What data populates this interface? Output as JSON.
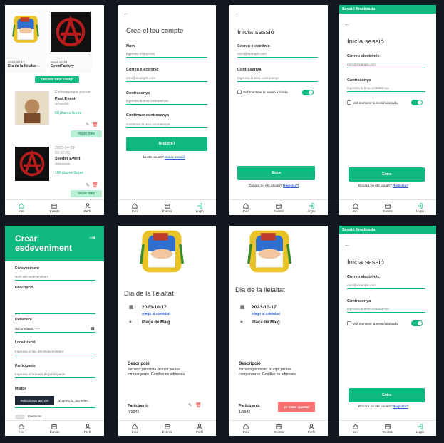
{
  "colors": {
    "accent": "#10b981",
    "danger": "#f87171",
    "link": "#2f5fd0"
  },
  "nav": {
    "home": "Inici",
    "events": "Events",
    "profile": "Perfil",
    "login": "Login"
  },
  "s1": {
    "cards": [
      {
        "date": "2023-10-17",
        "title": "Dia de la lleialtat"
      },
      {
        "date": "2023-12-31",
        "title": "EventFactory"
      }
    ],
    "create_btn": "CREATE NEW EVENT",
    "events": [
      {
        "status": "Esdeveniment passat",
        "title": "Past Event",
        "org": "@Factoria5",
        "places": "50 places lliures",
        "more": "Veure més"
      },
      {
        "date": "2023-04-29",
        "time": "00:00:00",
        "title": "Seeder Event",
        "org": "@Barcelona",
        "places": "100 places lliures",
        "more": "Veure més"
      }
    ]
  },
  "s2": {
    "title": "Crea el teu compte",
    "name_label": "Nom",
    "name_ph": "Ingressa el teu nom",
    "email_label": "Correu electrònic",
    "email_ph": "nom@example.com",
    "pass_label": "Contrasenya",
    "pass_ph": "Ingressa la teva contrasenya",
    "conf_label": "Confirmar contrasenya",
    "conf_ph": "Confirmar la teva contrasenya",
    "btn": "Registra't",
    "q": "Ja ets usuari?",
    "link": "Inicia sessió"
  },
  "login": {
    "title": "Inicia sessió",
    "email_label": "Correu electrònic",
    "email_ph": "nom@example.com",
    "pass_label": "Contrasenya",
    "pass_ph": "Ingressa la teva contrasenya",
    "remember": "Vull mantenir la sessió iniciada",
    "btn": "Entra",
    "q": "Encara no ets usuari?",
    "link": "Registra't",
    "banner": "Sessió finalitzada"
  },
  "s5": {
    "title": "Crear esdeveniment",
    "ev_label": "Esdeveniment",
    "ev_ph": "Nom del esdeveniment",
    "desc_label": "Descripció",
    "date_label": "Data/Hora",
    "date_ph": "dd/mm/aaaa, --:--",
    "loc_label": "Localització",
    "loc_ph": "Ingressa el lloc del esdeveniment",
    "part_label": "Participants",
    "part_ph": "Ingressa el número de participants",
    "img_label": "Imatge",
    "file_btn": "Seleccionar archivo",
    "file_name": "Ninguno a...ivo selec.",
    "featured": "Destacat"
  },
  "detail": {
    "title": "Dia de la lleialtat",
    "date": "2023-10-17",
    "cal": "Afegir al calendari",
    "place": "Plaça de Maig",
    "desc_label": "Descripció",
    "desc": "Jornada peronista. Xoripà per les companyeres. Gorrilles no admeses.",
    "part_label": "Participants",
    "part_a": "0/1945",
    "part_b": "1/1945",
    "joined": "Je estas apuntat"
  }
}
